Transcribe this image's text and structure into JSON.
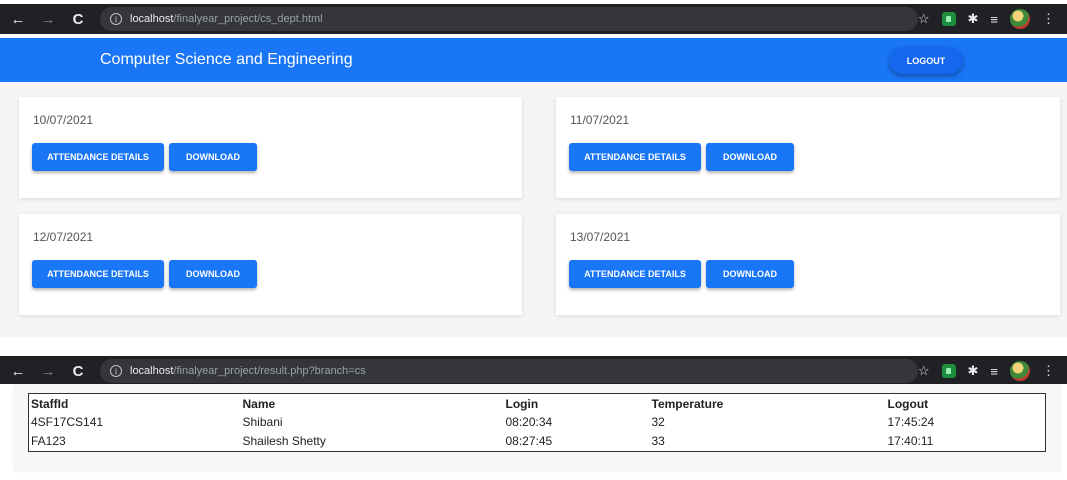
{
  "browser1": {
    "url_host": "localhost",
    "url_path": "/finalyear_project/cs_dept.html"
  },
  "header": {
    "title": "Computer Science and Engineering",
    "logout_label": "LOGOUT"
  },
  "cards": [
    {
      "date": "10/07/2021",
      "attendance_label": "ATTENDANCE DETAILS",
      "download_label": "DOWNLOAD"
    },
    {
      "date": "11/07/2021",
      "attendance_label": "ATTENDANCE DETAILS",
      "download_label": "DOWNLOAD"
    },
    {
      "date": "12/07/2021",
      "attendance_label": "ATTENDANCE DETAILS",
      "download_label": "DOWNLOAD"
    },
    {
      "date": "13/07/2021",
      "attendance_label": "ATTENDANCE DETAILS",
      "download_label": "DOWNLOAD"
    }
  ],
  "browser2": {
    "url_host": "localhost",
    "url_path": "/finalyear_project/result.php?branch=cs"
  },
  "table": {
    "headers": [
      "StaffId",
      "Name",
      "Login",
      "Temperature",
      "Logout"
    ],
    "rows": [
      [
        "4SF17CS141",
        "Shibani",
        "08:20:34",
        "32",
        "17:45:24"
      ],
      [
        "FA123",
        "Shailesh Shetty",
        "08:27:45",
        "33",
        "17:40:11"
      ]
    ]
  },
  "icons": {
    "back": "arrow-left-icon",
    "forward": "arrow-right-icon",
    "reload": "reload-icon",
    "info": "info-icon",
    "star": "star-icon",
    "extensions": "puzzle-icon",
    "reading_list": "reading-list-icon",
    "menu": "more-vertical-icon"
  },
  "colors": {
    "primary": "#1976f7",
    "chrome_dark": "#202124"
  }
}
